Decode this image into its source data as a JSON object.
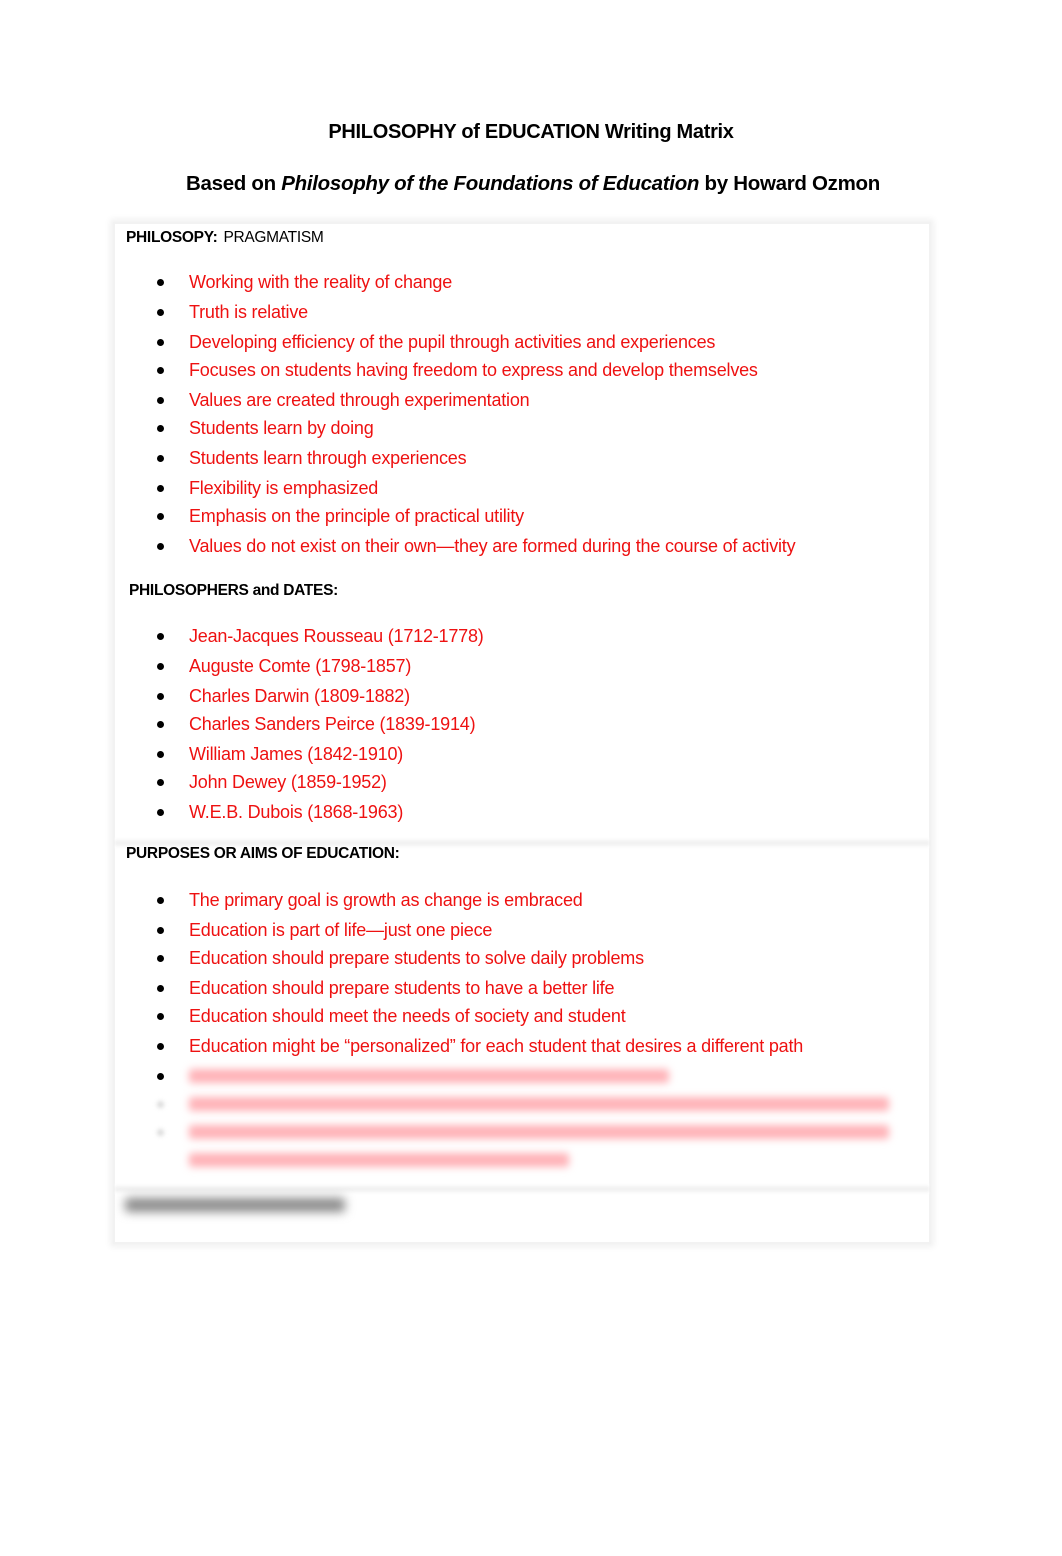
{
  "document": {
    "title": "PHILOSOPHY of EDUCATION Writing Matrix",
    "subtitle": {
      "prefix": "Based on ",
      "book_title": "Philosophy of the Foundations of Education",
      "suffix": " by Howard Ozmon"
    }
  },
  "colors": {
    "answer_text": "#ee1111",
    "heading_text": "#000000"
  },
  "philosophy": {
    "label": "PHILOSOPY:",
    "value": "PRAGMATISM",
    "items": [
      "Working with the reality of change",
      "Truth is relative",
      "Developing efficiency of the pupil through activities and experiences",
      "Focuses on students having freedom to express and develop themselves",
      "Values are created through experimentation",
      "Students learn by doing",
      "Students learn through experiences",
      "Flexibility is emphasized",
      "Emphasis on the principle of practical utility",
      "Values do not exist on their own—they are formed during the course of activity"
    ]
  },
  "philosophers": {
    "label": "PHILOSOPHERS and DATES:",
    "items": [
      "Jean-Jacques Rousseau (1712-1778)",
      "Auguste Comte (1798-1857)",
      "Charles Darwin (1809-1882)",
      "Charles Sanders Peirce (1839-1914)",
      "William James (1842-1910)",
      "John Dewey (1859-1952)",
      "W.E.B. Dubois (1868-1963)"
    ]
  },
  "purposes": {
    "label": "PURPOSES OR AIMS OF EDUCATION:",
    "items": [
      "The primary goal is growth as change is embraced",
      "Education is part of life—just one piece",
      "Education should prepare students to solve daily problems",
      "Education should prepare students to have a better life",
      "Education should meet the needs of society and student",
      "Education might be “personalized” for each student that desires a different path"
    ],
    "blurred_items_count": 3
  },
  "methods": {
    "label_blurred": true
  }
}
